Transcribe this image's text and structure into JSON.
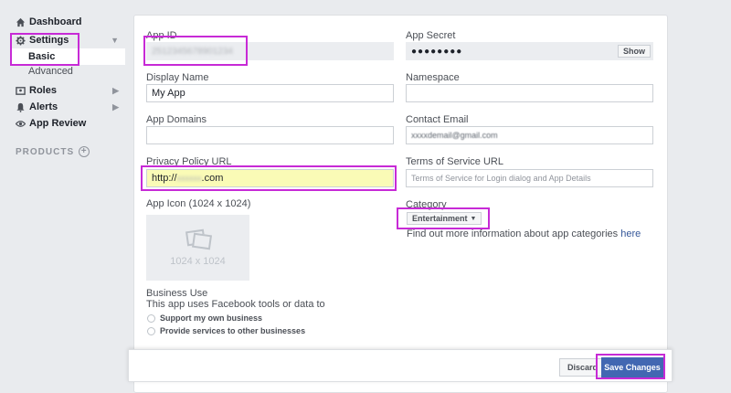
{
  "sidebar": {
    "dashboard": "Dashboard",
    "settings": "Settings",
    "basic": "Basic",
    "advanced": "Advanced",
    "roles": "Roles",
    "alerts": "Alerts",
    "app_review": "App Review",
    "products": "PRODUCTS"
  },
  "form": {
    "app_id_label": "App ID",
    "app_id_value": "2512345678901234",
    "app_secret_label": "App Secret",
    "app_secret_value": "●●●●●●●●",
    "show_label": "Show",
    "display_name_label": "Display Name",
    "display_name_value": "My App",
    "namespace_label": "Namespace",
    "namespace_value": "",
    "app_domains_label": "App Domains",
    "app_domains_value": "",
    "contact_email_label": "Contact Email",
    "contact_email_value": "xxxxdemail@gmail.com",
    "privacy_label": "Privacy Policy URL",
    "privacy_prefix": "http://",
    "privacy_blurred": "xxxxxx",
    "privacy_suffix": ".com",
    "tos_label": "Terms of Service URL",
    "tos_placeholder": "Terms of Service for Login dialog and App Details",
    "app_icon_label": "App Icon (1024 x 1024)",
    "app_icon_size": "1024 x 1024",
    "category_label": "Category",
    "category_value": "Entertainment",
    "category_help": "Find out more information about app categories",
    "category_help_link": "here",
    "business_use_label": "Business Use",
    "business_use_desc": "This app uses Facebook tools or data to",
    "radio_own": "Support my own business",
    "radio_other": "Provide services to other businesses"
  },
  "actions": {
    "discard": "Discard",
    "save": "Save Changes"
  },
  "colors": {
    "highlight": "#c72ad6",
    "primary": "#4267b2",
    "link": "#365899"
  }
}
